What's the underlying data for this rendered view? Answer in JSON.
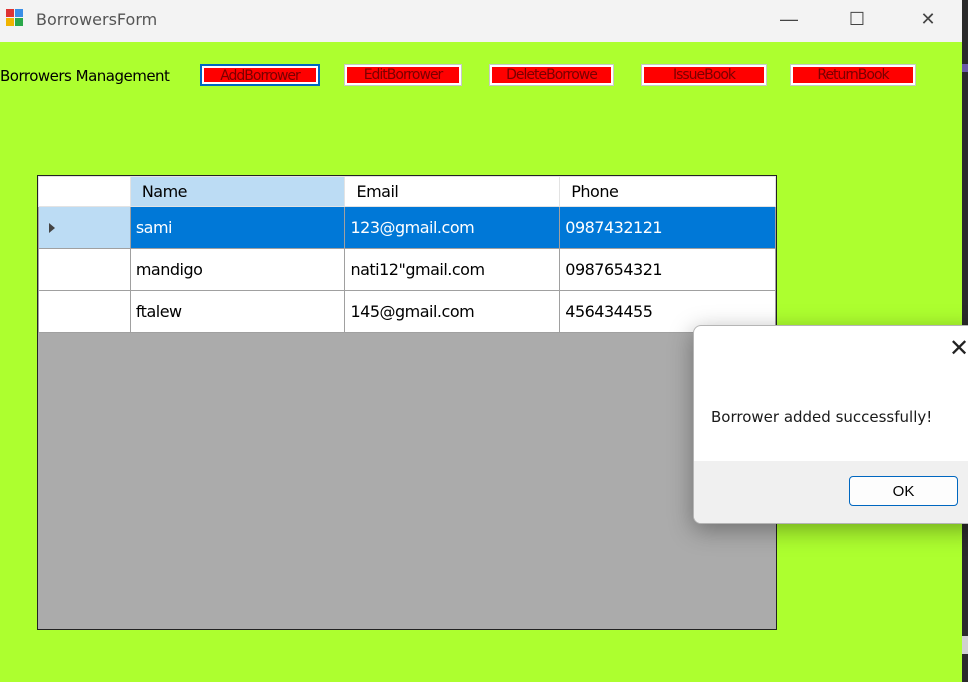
{
  "window": {
    "title": "BorrowersForm",
    "minimize": "—",
    "maximize": "☐",
    "close": "✕"
  },
  "header": {
    "label": "Borrowers Management"
  },
  "toolbar": {
    "add": "AddBorrower",
    "edit": "EditBorrower",
    "delete": "DeleteBorrowe",
    "issue": "IssueBook",
    "return": "ReturnBook"
  },
  "grid": {
    "columns": [
      "Name",
      "Email",
      "Phone"
    ],
    "rows": [
      {
        "name": "sami",
        "email": "123@gmail.com",
        "phone": "0987432121"
      },
      {
        "name": "mandigo",
        "email": "nati12\"gmail.com",
        "phone": "0987654321"
      },
      {
        "name": "ftalew",
        "email": "145@gmail.com",
        "phone": "456434455"
      }
    ]
  },
  "dialog": {
    "message": "Borrower added successfully!",
    "ok": "OK",
    "close": "✕"
  },
  "colors": {
    "form_background": "#adff2f",
    "button_fill": "#ff0000",
    "selection": "#0078d7"
  }
}
